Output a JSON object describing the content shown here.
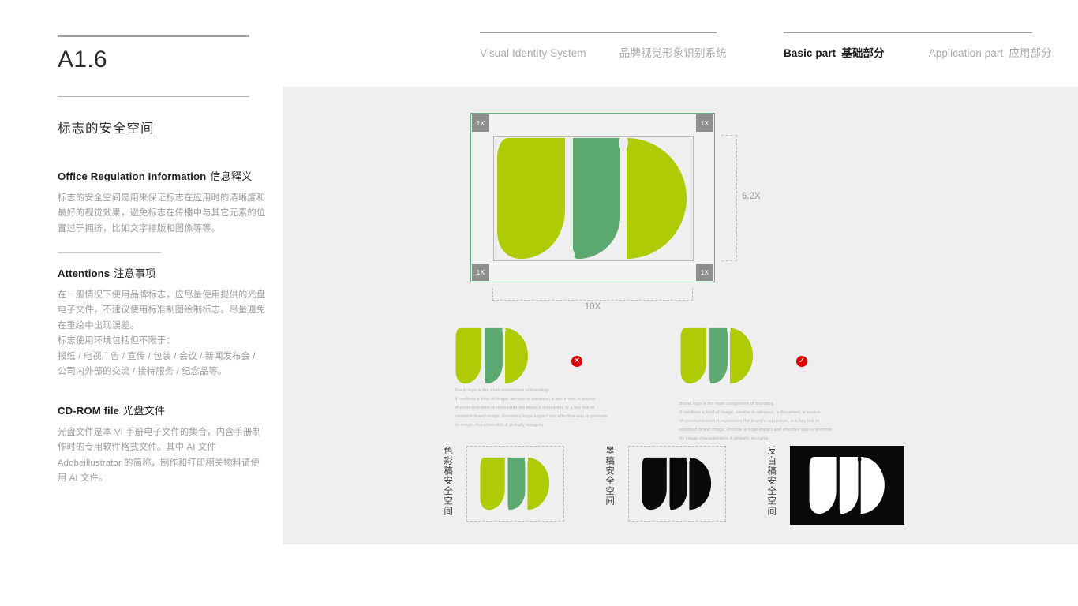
{
  "nav": {
    "left": [
      {
        "en": "Visual Identity System",
        "cn": "",
        "active": false
      },
      {
        "en": "",
        "cn": "品牌视觉形象识别系统",
        "active": false
      }
    ],
    "right": [
      {
        "en": "Basic part",
        "cn": "基础部分",
        "active": true
      },
      {
        "en": "Application part",
        "cn": "应用部分",
        "active": false
      }
    ]
  },
  "sidebar": {
    "doc_code": "A1.6",
    "doc_title": "标志的安全空间",
    "sections": [
      {
        "head_en": "Office Regulation Information",
        "head_cn": "信息释义",
        "body": "标志的安全空间是用来保证标志在应用时的清晰度和最好的视觉效果，避免标志在传播中与其它元素的位置过于拥挤，比如文字排版和图像等等。"
      },
      {
        "head_en": "Attentions",
        "head_cn": "注意事项",
        "body_lines": [
          "在一般情况下使用品牌标志，应尽量使用提供的光盘电子文件，不建议使用标准制图绘制标志。尽量避免在重绘中出现误差。",
          "标志使用环境包括但不限于：",
          "报纸 / 电视广告 / 宣传 / 包装 / 会议 / 新闻发布会 / 公司内外部的交流 / 接待服务 / 纪念品等。"
        ]
      },
      {
        "head_en": "CD-ROM file",
        "head_cn": "光盘文件",
        "body": "光盘文件是本 VI 手册电子文件的集合，内含手册制作时的专用软件格式文件。其中 AI 文件 Adobeillustrator 的简称，制作和打印相关物料请使用 AI 文件。"
      }
    ]
  },
  "diagram": {
    "corner_label": "1X",
    "height_label": "6.2X",
    "width_label": "10X"
  },
  "comparison": {
    "paragraph_lines": [
      "Brand logo is the main component of branding.",
      "It confirms a kind of image, service in advance, a document, a source",
      "of communication;It represents the brand's reputation, is a key link to",
      "establish brand image. Provide a huge impact and effective way to promote",
      "its image characteristics.A globally recognis"
    ],
    "bad_badge": "✕",
    "good_badge": "✓"
  },
  "variants": [
    {
      "label": "色彩稿安全空间",
      "style": "color"
    },
    {
      "label": "墨稿安全空间",
      "style": "ink"
    },
    {
      "label": "反白稿安全空间",
      "style": "reverse"
    }
  ],
  "colors": {
    "light_green": "#aecb05",
    "dark_green": "#5ba871",
    "panel_bg": "#efefef",
    "frame_green": "#6aa97f",
    "badge_red": "#e00000",
    "ink_black": "#0a0a0a"
  }
}
